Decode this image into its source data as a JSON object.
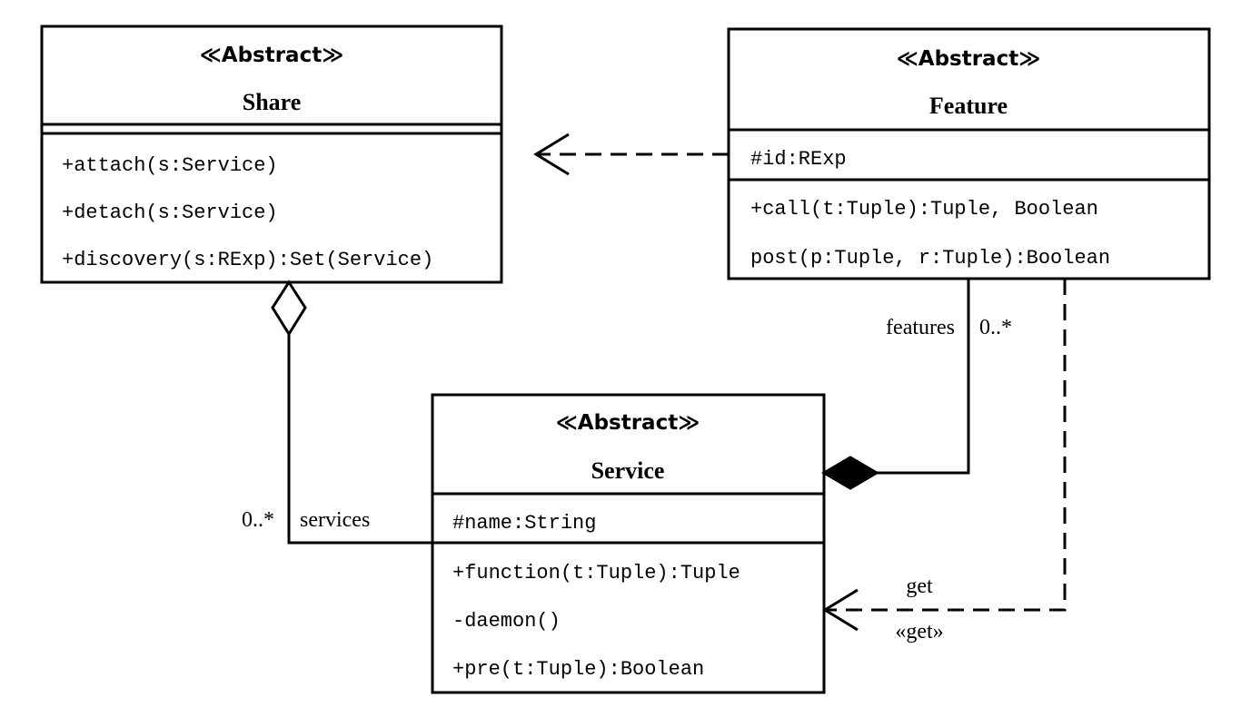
{
  "classes": {
    "share": {
      "stereotype": "≪Abstract≫",
      "name": "Share",
      "attributes": [],
      "methods": [
        "+attach(s:Service)",
        "+detach(s:Service)",
        "+discovery(s:RExp):Set(Service)"
      ]
    },
    "feature": {
      "stereotype": "≪Abstract≫",
      "name": "Feature",
      "attributes": [
        "#id:RExp"
      ],
      "methods": [
        "+call(t:Tuple):Tuple, Boolean",
        "post(p:Tuple, r:Tuple):Boolean"
      ]
    },
    "service": {
      "stereotype": "≪Abstract≫",
      "name": "Service",
      "attributes": [
        "#name:String"
      ],
      "methods": [
        "+function(t:Tuple):Tuple",
        "-daemon()",
        "+pre(t:Tuple):Boolean"
      ]
    }
  },
  "relations": {
    "feature_share": {
      "type": "dependency",
      "from": "Feature",
      "to": "Share"
    },
    "share_service": {
      "type": "aggregation",
      "whole": "Share",
      "part": "Service",
      "role": "services",
      "multiplicity": "0..*"
    },
    "service_feature": {
      "type": "composition",
      "whole": "Service",
      "part": "Feature",
      "role": "features",
      "multiplicity": "0..*"
    },
    "feature_service_get": {
      "type": "dependency",
      "from": "Feature",
      "to": "Service",
      "label": "get",
      "stereotype": "«get»"
    }
  }
}
